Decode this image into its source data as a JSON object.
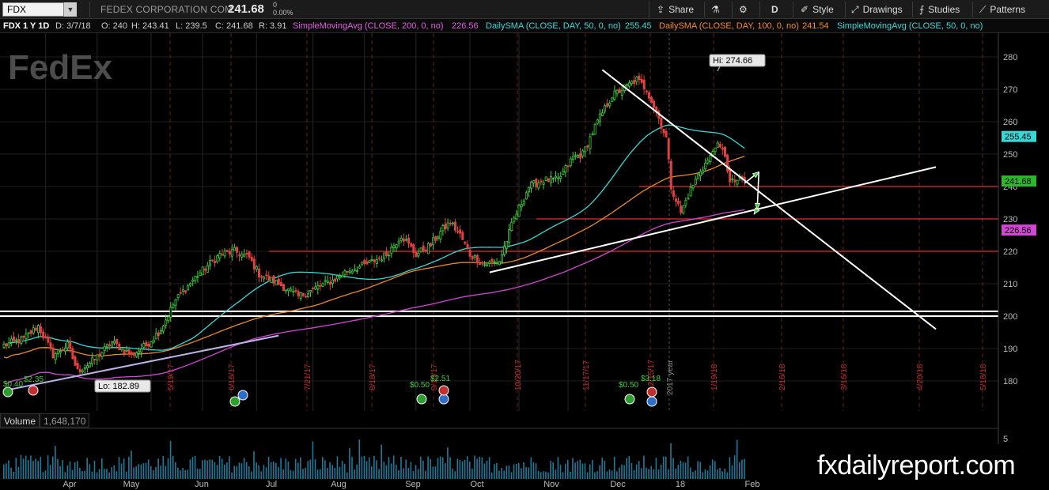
{
  "toolbar": {
    "symbol": "FDX",
    "company": "FEDEX CORPORATION COM",
    "last_price": "241.68",
    "change_abs": "0",
    "change_pct": "0.00%",
    "share": "Share",
    "timeframe": "D",
    "style": "Style",
    "drawings": "Drawings",
    "studies": "Studies",
    "patterns": "Patterns"
  },
  "header": {
    "instrument": "FDX 1 Y 1D",
    "date": "D: 3/7/18",
    "open": "O: 240",
    "high": "H: 243.41",
    "low": "L: 239.5",
    "close": "C: 241.68",
    "range": "R: 3.91",
    "study1": "SimpleMovingAvg (CLOSE, 200, 0, no)",
    "study1_val": "226.56",
    "study2": "DailySMA (CLOSE, DAY, 50, 0, no)",
    "study2_val": "255.45",
    "study3": "DailySMA (CLOSE, DAY, 100, 0, no)",
    "study3_val": "241.54",
    "study4": "SimpleMovingAvg (CLOSE, 50, 0, no)"
  },
  "logo_text": "FedEx",
  "volume": {
    "label": "Volume",
    "value": "1,648,170",
    "axis_tick": "5"
  },
  "watermark": "fxdailyreport.com",
  "colors": {
    "up": "#3fcf3f",
    "down": "#e04040",
    "sma200": "#d047d0",
    "sma50": "#3ad6d6",
    "sma100": "#e8892b",
    "trend": "#ffffff",
    "support": "#e03030",
    "hdr_study1": "#e060e0",
    "hdr_study2": "#40d8d8",
    "hdr_study3": "#f08a30",
    "hdr_study4": "#40d8d8"
  },
  "chart_data": {
    "type": "candlestick",
    "y_ticks": [
      180,
      190,
      200,
      210,
      220,
      230,
      240,
      250,
      260,
      270,
      280
    ],
    "ylim": [
      172,
      283
    ],
    "x_labels": [
      "Apr",
      "May",
      "Jun",
      "Jul",
      "Aug",
      "Sep",
      "Oct",
      "Nov",
      "Dec",
      "18",
      "Feb"
    ],
    "future_dates": [
      "5/19/17",
      "6/16/17",
      "7/21/17",
      "8/18/17",
      "9/15/17",
      "10/20/17",
      "11/17/17",
      "12/15/17",
      "1/19/18",
      "2/16/18",
      "3/16/18",
      "4/20/18",
      "5/18/18"
    ],
    "year_marker": "2017 year",
    "hi_label": "Hi: 274.66",
    "lo_label": "Lo: 182.89",
    "price_tags": [
      {
        "value": 255.45,
        "label": "255.45",
        "color": "#3ad6d6"
      },
      {
        "value": 241.68,
        "label": "241.68",
        "color": "#2fb52f"
      },
      {
        "value": 226.56,
        "label": "226.56",
        "color": "#d047d0"
      }
    ],
    "horizontal_levels": [
      200,
      201.5,
      220,
      230,
      240
    ],
    "dividends": [
      "$2.35",
      "$0.40",
      "$2.51",
      "$0.50",
      "$3.18",
      "$0.50"
    ],
    "anchors": [
      [
        0,
        191
      ],
      [
        8,
        193
      ],
      [
        14,
        197
      ],
      [
        20,
        188
      ],
      [
        26,
        191
      ],
      [
        30,
        183
      ],
      [
        36,
        186
      ],
      [
        44,
        192
      ],
      [
        52,
        188
      ],
      [
        58,
        191
      ],
      [
        64,
        196
      ],
      [
        70,
        205
      ],
      [
        78,
        212
      ],
      [
        88,
        219
      ],
      [
        94,
        220
      ],
      [
        100,
        218
      ],
      [
        104,
        213
      ],
      [
        112,
        210
      ],
      [
        120,
        206
      ],
      [
        128,
        209
      ],
      [
        134,
        211
      ],
      [
        140,
        214
      ],
      [
        148,
        216
      ],
      [
        156,
        219
      ],
      [
        162,
        225
      ],
      [
        168,
        219
      ],
      [
        174,
        222
      ],
      [
        178,
        226
      ],
      [
        182,
        229
      ],
      [
        186,
        225
      ],
      [
        190,
        219
      ],
      [
        196,
        216
      ],
      [
        202,
        217
      ],
      [
        208,
        230
      ],
      [
        214,
        240
      ],
      [
        220,
        242
      ],
      [
        226,
        242
      ],
      [
        232,
        249
      ],
      [
        236,
        250
      ],
      [
        242,
        260
      ],
      [
        248,
        268
      ],
      [
        254,
        271
      ],
      [
        258,
        273
      ],
      [
        262,
        270
      ],
      [
        266,
        263
      ],
      [
        270,
        255
      ],
      [
        272,
        240
      ],
      [
        276,
        232
      ],
      [
        280,
        239
      ],
      [
        284,
        245
      ],
      [
        288,
        249
      ],
      [
        290,
        253
      ],
      [
        294,
        250
      ],
      [
        296,
        241
      ],
      [
        299,
        242
      ],
      [
        302,
        241.68
      ]
    ],
    "trendlines": [
      {
        "x1": 0,
        "y1": 177,
        "x2": 112,
        "y2": 194,
        "color": "#bcb4e8"
      },
      {
        "x1": 198,
        "y1": 213.5,
        "x2": 380,
        "y2": 246
      },
      {
        "x1": 244,
        "y1": 276,
        "x2": 380,
        "y2": 196
      }
    ]
  }
}
